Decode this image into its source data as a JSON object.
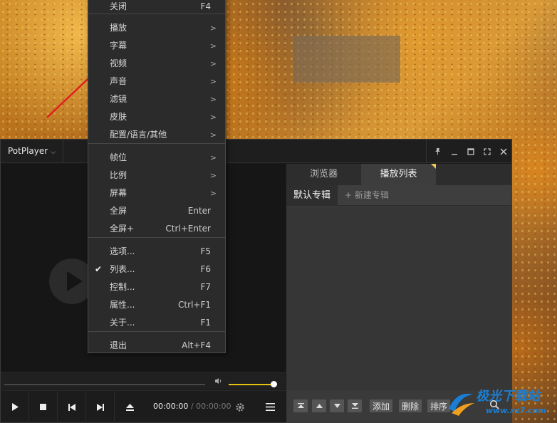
{
  "player": {
    "brand": "PotPlayer",
    "time_current": "00:00:00",
    "time_sep": "/",
    "time_total": "00:00:00",
    "logo_fragment": "r"
  },
  "panel": {
    "tabs": [
      {
        "label": "浏览器"
      },
      {
        "label": "播放列表"
      }
    ],
    "subtabs": [
      {
        "label": "默认专辑"
      },
      {
        "label": "+ 新建专辑"
      }
    ],
    "tools": {
      "add": "添加",
      "delete": "删除",
      "sort": "排序"
    }
  },
  "menu": {
    "items": [
      {
        "label": "关闭",
        "shortcut": "F4"
      },
      {
        "label": "播放",
        "submenu": ">"
      },
      {
        "label": "字幕",
        "submenu": ">"
      },
      {
        "label": "视频",
        "submenu": ">"
      },
      {
        "label": "声音",
        "submenu": ">"
      },
      {
        "label": "滤镜",
        "submenu": ">"
      },
      {
        "label": "皮肤",
        "submenu": ">"
      },
      {
        "label": "配置/语言/其他",
        "submenu": ">"
      },
      {
        "label": "帧位",
        "submenu": ">"
      },
      {
        "label": "比例",
        "submenu": ">"
      },
      {
        "label": "屏幕",
        "submenu": ">"
      },
      {
        "label": "全屏",
        "shortcut": "Enter"
      },
      {
        "label": "全屏+",
        "shortcut": "Ctrl+Enter"
      },
      {
        "label": "选项...",
        "shortcut": "F5"
      },
      {
        "label": "列表...",
        "shortcut": "F6",
        "checked": "✔"
      },
      {
        "label": "控制...",
        "shortcut": "F7"
      },
      {
        "label": "属性...",
        "shortcut": "Ctrl+F1"
      },
      {
        "label": "关于...",
        "shortcut": "F1"
      },
      {
        "label": "退出",
        "shortcut": "Alt+F4"
      }
    ]
  },
  "watermark": {
    "title": "极光下载站",
    "url": "www.xz7.com"
  },
  "colors": {
    "volume_accent": "#e5c20d",
    "arrow": "#e02020",
    "watermark": "#1a7fd4"
  },
  "volume_level": 0.95
}
